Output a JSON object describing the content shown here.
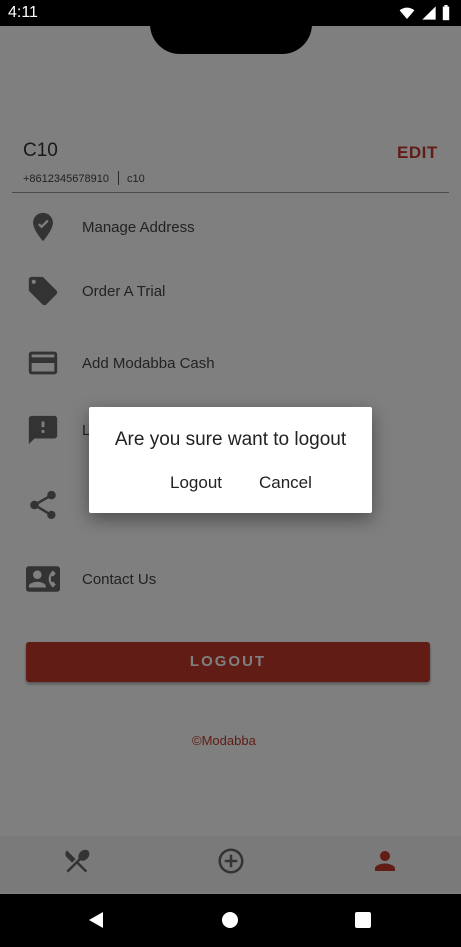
{
  "status_bar": {
    "time": "4:11"
  },
  "profile": {
    "name": "C10",
    "phone": "+8612345678910",
    "code": "c10",
    "edit_label": "EDIT"
  },
  "menu": {
    "items": [
      {
        "label": "Manage Address",
        "icon": "location-pin-icon"
      },
      {
        "label": "Order A Trial",
        "icon": "tag-icon"
      },
      {
        "label": "Add Modabba Cash",
        "icon": "credit-card-icon"
      },
      {
        "label": "L",
        "icon": "feedback-icon"
      },
      {
        "label": "",
        "icon": "share-icon"
      },
      {
        "label": "Contact Us",
        "icon": "contact-card-icon"
      }
    ]
  },
  "logout_button": {
    "label": "LOGOUT"
  },
  "footer": {
    "brand": "Modabba"
  },
  "bottom_nav": {
    "items": [
      "restaurant-icon",
      "add-circle-icon",
      "person-icon"
    ]
  },
  "dialog": {
    "message": "Are you sure want to logout",
    "confirm_label": "Logout",
    "cancel_label": "Cancel"
  },
  "colors": {
    "accent": "#c0392b"
  }
}
